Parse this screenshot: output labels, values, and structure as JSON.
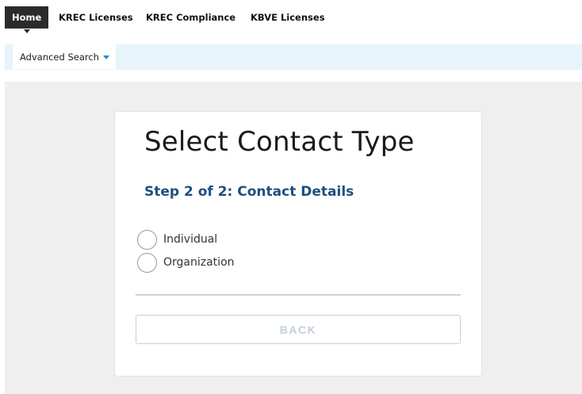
{
  "topnav": {
    "tabs": [
      {
        "label": "Home",
        "active": true
      },
      {
        "label": "KREC Licenses"
      },
      {
        "label": "KREC Compliance"
      },
      {
        "label": "KBVE Licenses"
      }
    ]
  },
  "subnav": {
    "items": [
      {
        "label": "Advanced Search",
        "icon": "chevron-down-icon"
      }
    ]
  },
  "card": {
    "title": "Select Contact Type",
    "step_title": "Step 2 of 2: Contact Details",
    "options": [
      {
        "label": "Individual",
        "selected": false
      },
      {
        "label": "Organization",
        "selected": false
      }
    ],
    "back_label": "BACK"
  },
  "colors": {
    "nav_active_bg": "#2b2b2b",
    "subnav_bg": "#e8f4fb",
    "content_bg": "#efefef",
    "step_title": "#1e4f80",
    "dropdown_accent": "#2a8ad4",
    "back_button_text": "#c3cfda"
  }
}
